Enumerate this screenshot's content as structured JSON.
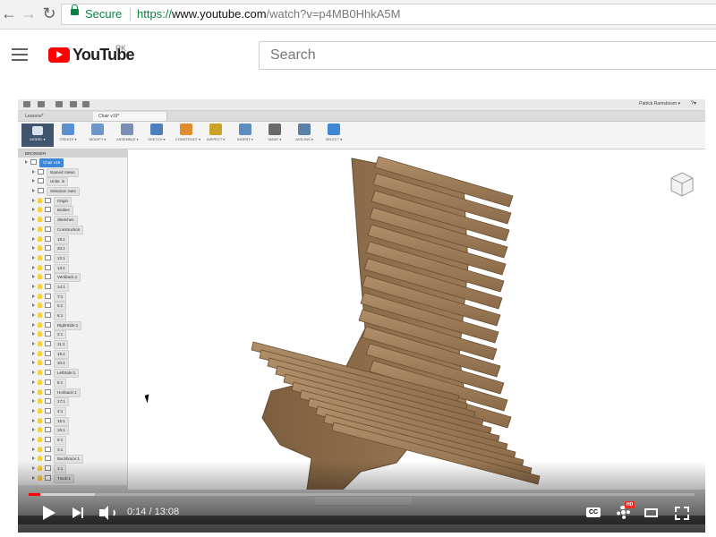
{
  "browser": {
    "secure_label": "Secure",
    "url_protocol": "https://",
    "url_domain": "www.youtube.com",
    "url_path": "/watch?v=p4MB0HhkA5M"
  },
  "youtube": {
    "logo_text": "YouTube",
    "country_code": "PK",
    "search_placeholder": "Search"
  },
  "fusion": {
    "user_name": "Patrick Ramsbosm ▾",
    "help": "?▾",
    "tabs": [
      "Lessons*",
      "Chair v19*"
    ],
    "ribbon": [
      {
        "label": "MODEL ▾",
        "color": "#41546d"
      },
      {
        "label": "CREATE ▾",
        "color": "#5b8fd1"
      },
      {
        "label": "MODIFY ▾",
        "color": "#6f96c9"
      },
      {
        "label": "ASSEMBLE ▾",
        "color": "#7a8fb3"
      },
      {
        "label": "SKETCH ▾",
        "color": "#4d7fbf"
      },
      {
        "label": "CONSTRUCT ▾",
        "color": "#e08b2c"
      },
      {
        "label": "INSPECT ▾",
        "color": "#c9a227"
      },
      {
        "label": "INSERT ▾",
        "color": "#5c8fbf"
      },
      {
        "label": "MAKE ▾",
        "color": "#6a6a6a"
      },
      {
        "label": "ADD-INS ▾",
        "color": "#5a7fa8"
      },
      {
        "label": "SELECT ▾",
        "color": "#3d86d8"
      }
    ],
    "browser_title": "BROWSER",
    "tree": [
      {
        "name": "Chair v19",
        "level": 0,
        "selected": true
      },
      {
        "name": "Named Views",
        "level": 1
      },
      {
        "name": "Units: in",
        "level": 1
      },
      {
        "name": "Selection Sets",
        "level": 1
      },
      {
        "name": "Origin",
        "level": 1
      },
      {
        "name": "Bodies",
        "level": 1
      },
      {
        "name": "Sketches",
        "level": 1
      },
      {
        "name": "Construction",
        "level": 1
      },
      {
        "name": "18:1",
        "level": 1
      },
      {
        "name": "20:1",
        "level": 1
      },
      {
        "name": "12:1",
        "level": 1
      },
      {
        "name": "13:1",
        "level": 1
      },
      {
        "name": "Vertiback:1",
        "level": 1
      },
      {
        "name": "14:1",
        "level": 1
      },
      {
        "name": "7:1",
        "level": 1
      },
      {
        "name": "5:1",
        "level": 1
      },
      {
        "name": "6:1",
        "level": 1
      },
      {
        "name": "RightSide:1",
        "level": 1
      },
      {
        "name": "2:1",
        "level": 1
      },
      {
        "name": "11:1",
        "level": 1
      },
      {
        "name": "19:1",
        "level": 1
      },
      {
        "name": "10:1",
        "level": 1
      },
      {
        "name": "LeftSide:1",
        "level": 1
      },
      {
        "name": "8:1",
        "level": 1
      },
      {
        "name": "Horiback:1",
        "level": 1
      },
      {
        "name": "17:1",
        "level": 1
      },
      {
        "name": "4:1",
        "level": 1
      },
      {
        "name": "15:1",
        "level": 1
      },
      {
        "name": "16:1",
        "level": 1
      },
      {
        "name": "9:1",
        "level": 1
      },
      {
        "name": "3:1",
        "level": 1
      },
      {
        "name": "Backbrace:1",
        "level": 1
      },
      {
        "name": "1:1",
        "level": 1
      },
      {
        "name": "Track:1",
        "level": 1
      }
    ]
  },
  "player": {
    "current_time": "0:14",
    "duration": "13:08",
    "time_display": "0:14 / 13:08",
    "progress_fraction": 0.018,
    "buffered_fraction": 0.1,
    "hd_badge": "HD",
    "cc_label": "CC",
    "accent_color": "#ff0000"
  }
}
